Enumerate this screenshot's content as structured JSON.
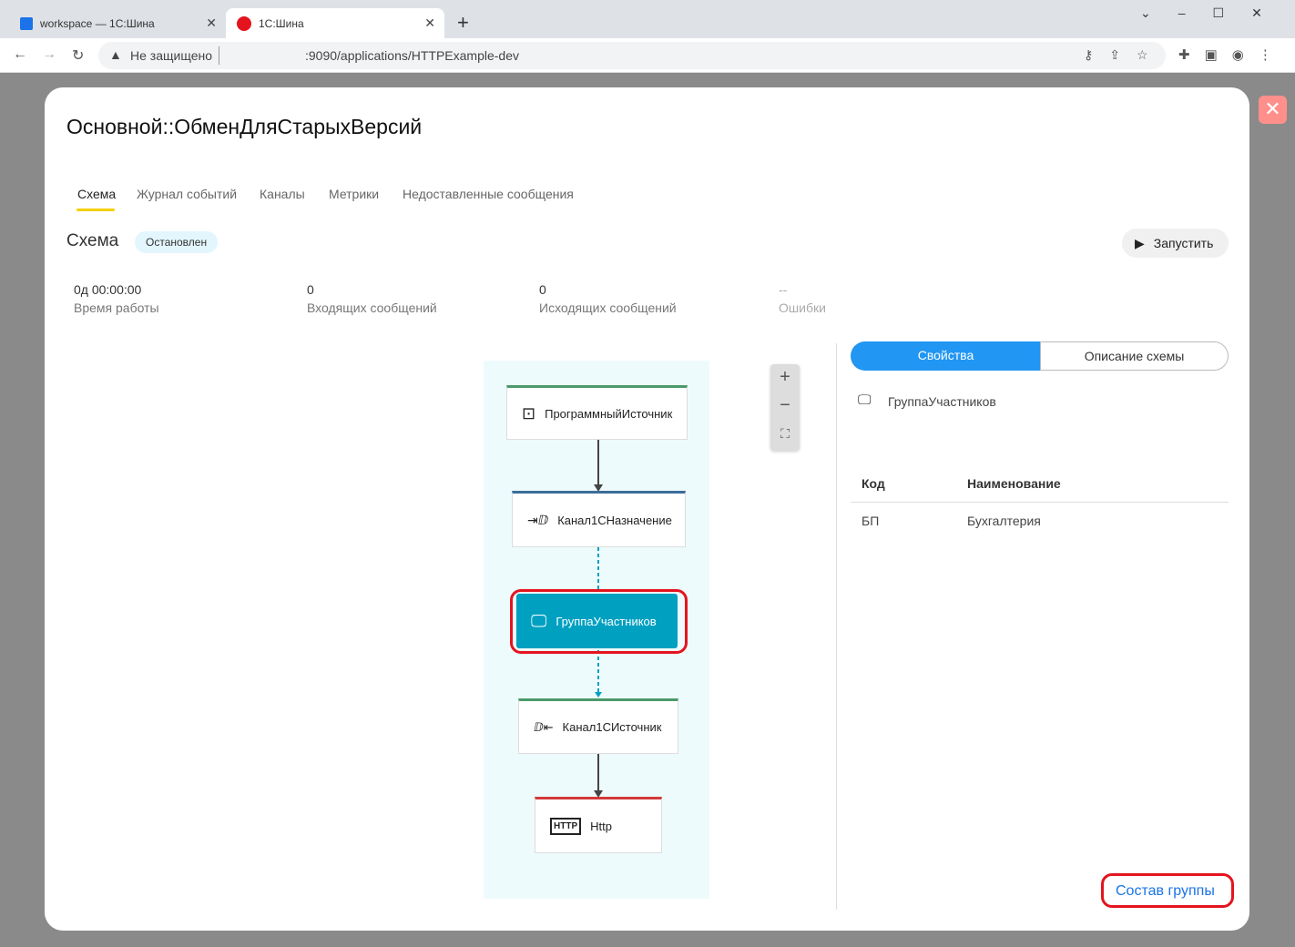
{
  "browser": {
    "tabs": [
      {
        "label": "workspace — 1C:Шина"
      },
      {
        "label": "1С:Шина"
      }
    ],
    "security": "Не защищено",
    "url": ":9090/applications/HTTPExample-dev"
  },
  "modal": {
    "title": "Основной::ОбменДляСтарыхВерсий",
    "tabs": [
      "Схема",
      "Журнал событий",
      "Каналы",
      "Метрики",
      "Недоставленные сообщения"
    ],
    "section_title": "Схема",
    "status": "Остановлен",
    "run_label": "Запустить",
    "stats": [
      {
        "value": "0д 00:00:00",
        "label": "Время работы"
      },
      {
        "value": "0",
        "label": "Входящих сообщений"
      },
      {
        "value": "0",
        "label": "Исходящих сообщений"
      },
      {
        "value": "--",
        "label": "Ошибки"
      }
    ],
    "nodes": [
      {
        "label": "ПрограммныйИсточник",
        "color": "#4a9a6a"
      },
      {
        "label": "Канал1СНазначение",
        "color": "#3c6d99"
      },
      {
        "label": "ГруппаУчастников",
        "color": "#00a0c1"
      },
      {
        "label": "Канал1СИсточник",
        "color": "#4a9a6a"
      },
      {
        "label": "Http",
        "color": "#d33a3a"
      }
    ],
    "panel": {
      "tabs": [
        "Свойства",
        "Описание схемы"
      ],
      "selected": "ГруппаУчастников",
      "columns": [
        "Код",
        "Наименование"
      ],
      "rows": [
        [
          "БП",
          "Бухгалтерия"
        ]
      ],
      "link": "Состав группы"
    }
  }
}
